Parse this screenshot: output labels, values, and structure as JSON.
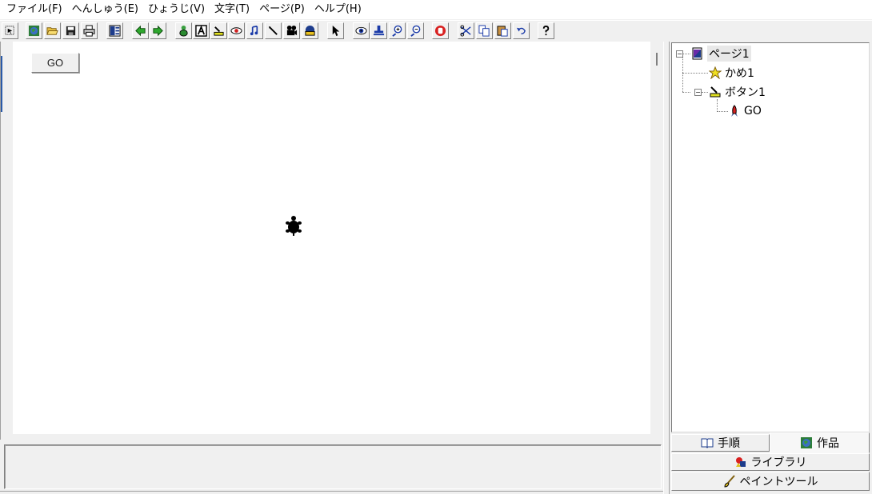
{
  "menubar": {
    "items": [
      {
        "label": "ファイル(F)"
      },
      {
        "label": "へんしゅう(E)"
      },
      {
        "label": "ひょうじ(V)"
      },
      {
        "label": "文字(T)"
      },
      {
        "label": "ページ(P)"
      },
      {
        "label": "ヘルプ(H)"
      }
    ]
  },
  "canvas": {
    "go_button_label": "GO"
  },
  "tree": {
    "page": "ページ1",
    "turtle": "かめ1",
    "button": "ボタン1",
    "action": "GO"
  },
  "tabs": {
    "procedure": "手順",
    "work": "作品",
    "library": "ライブラリ",
    "paint_tool": "ペイントツール"
  },
  "colors": {
    "canvas_bg": "#ffffff",
    "window_bg": "#f0f0f0",
    "turtle": "#000000"
  }
}
